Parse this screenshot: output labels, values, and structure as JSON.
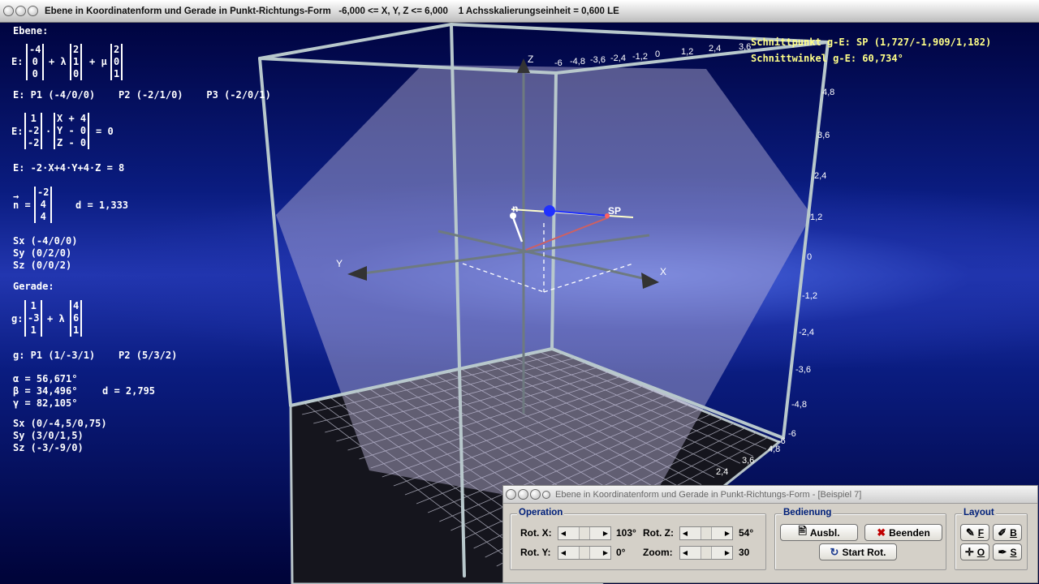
{
  "window": {
    "title": "Ebene in Koordinatenform und Gerade in Punkt-Richtungs-Form   -6,000 <= X, Y, Z <= 6,000    1 Achsskalierungseinheit = 0,600 LE"
  },
  "left_info": {
    "plane_heading": "Ebene:",
    "plane_param": {
      "prefix": "E:",
      "v1": [
        "-4",
        "0",
        "0"
      ],
      "op1": "+ λ",
      "v2": [
        "2",
        "1",
        "0"
      ],
      "op2": "+ μ",
      "v3": [
        "2",
        "0",
        "1"
      ]
    },
    "plane_points": "E: P1 (-4/0/0)    P2 (-2/1/0)    P3 (-2/0/1)",
    "plane_normal_form": {
      "prefix": "E:",
      "n": [
        "1",
        "-2",
        "-2"
      ],
      "dot": "·",
      "xv": [
        "X + 4",
        "Y - 0",
        "Z - 0"
      ],
      "eq": "= 0"
    },
    "plane_coord_form": "E: -2·X+4·Y+4·Z = 8",
    "normal_vector": {
      "arrow": "→",
      "label": "n =",
      "v": [
        "-2",
        "4",
        "4"
      ],
      "distance": "d = 1,333"
    },
    "plane_intercepts": [
      "Sx (-4/0/0)",
      "Sy (0/2/0)",
      "Sz (0/0/2)"
    ],
    "line_heading": "Gerade:",
    "line_param": {
      "prefix": "g:",
      "v1": [
        "1",
        "-3",
        "1"
      ],
      "op": "+ λ",
      "v2": [
        "4",
        "6",
        "1"
      ]
    },
    "line_points": "g: P1 (1/-3/1)    P2 (5/3/2)",
    "angles": [
      "α = 56,671°",
      "β = 34,496°",
      "γ = 82,105°"
    ],
    "line_distance": "d = 2,795",
    "line_intercepts": [
      "Sx (0/-4,5/0,75)",
      "Sy (3/0/1,5)",
      "Sz (-3/-9/0)"
    ]
  },
  "results": {
    "intersection_point": "Schnittpunkt g-E: SP (1,727/-1,909/1,182)",
    "intersection_angle": "Schnittwinkel g-E: 60,734°"
  },
  "scene_labels": {
    "x": "X",
    "y": "Y",
    "z": "Z",
    "n": "n",
    "sp": "SP"
  },
  "top_ticks": [
    "-6",
    "-4,8",
    "-3,6",
    "-2,4",
    "-1,2",
    "0",
    "1,2",
    "2,4",
    "3,6"
  ],
  "right_ticks": [
    "4,8",
    "3,6",
    "2,4",
    "1,2",
    "0",
    "-1,2",
    "-2,4",
    "-3,6",
    "-4,8",
    "-6"
  ],
  "bottom_ticks": [
    "-6",
    "4,8",
    "3,6",
    "2,4"
  ],
  "panel": {
    "title": "Ebene in Koordinatenform und Gerade in Punkt-Richtungs-Form - [Beispiel 7]",
    "operation": {
      "label": "Operation",
      "rot_x": {
        "label": "Rot. X:",
        "value": "103°"
      },
      "rot_y": {
        "label": "Rot. Y:",
        "value": "0°"
      },
      "rot_z": {
        "label": "Rot. Z:",
        "value": "54°"
      },
      "zoom": {
        "label": "Zoom:",
        "value": "30"
      }
    },
    "bedienung": {
      "label": "Bedienung",
      "ausbl": "Ausbl.",
      "beenden": "Beenden",
      "start_rot": "Start Rot."
    },
    "layout": {
      "label": "Layout",
      "f": "F",
      "b": "B",
      "o": "O",
      "s": "S"
    }
  }
}
